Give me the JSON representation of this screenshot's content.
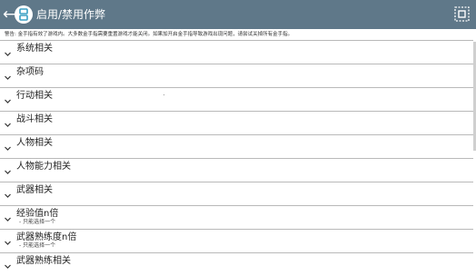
{
  "header": {
    "back_icon": "back-arrow-icon",
    "logo_icon": "app-logo-icon",
    "title": "启用/禁用作弊",
    "menu_icon": "select-all-icon",
    "bar_color": "#5f7889"
  },
  "warning": "警告: 金手指有效了游戏内。大多数金手指需要重置游戏才能关闭。如果加开启金手指导致游戏出现问题，请尝试关掉所有金手指。",
  "categories": [
    {
      "label": "系统相关",
      "sub": ""
    },
    {
      "label": "杂项码",
      "sub": ""
    },
    {
      "label": "行动相关",
      "sub": ""
    },
    {
      "label": "战斗相关",
      "sub": ""
    },
    {
      "label": "人物相关",
      "sub": ""
    },
    {
      "label": "人物能力相关",
      "sub": ""
    },
    {
      "label": "武器相关",
      "sub": ""
    },
    {
      "label": "经验值n倍",
      "sub": "- 只能选择一个"
    },
    {
      "label": "武器熟练度n倍",
      "sub": "- 只能选择一个"
    },
    {
      "label": "武器熟练相关",
      "sub": ""
    }
  ]
}
